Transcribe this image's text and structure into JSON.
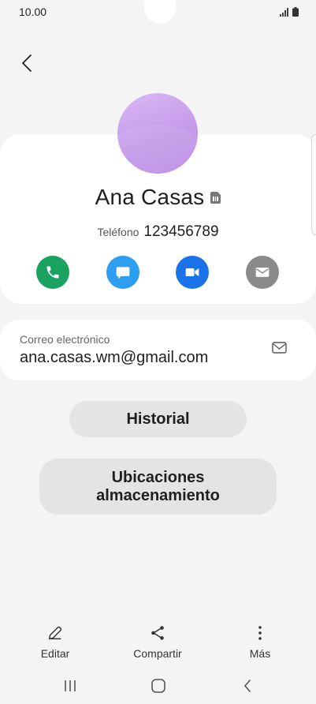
{
  "status_bar": {
    "time": "10.00"
  },
  "contact": {
    "name": "Ana Casas",
    "phone_label": "Teléfono",
    "phone_number": "123456789"
  },
  "actions": [
    {
      "name": "call",
      "icon": "phone-icon",
      "color": "#1aa260"
    },
    {
      "name": "message",
      "icon": "message-icon",
      "color": "#2e9ff0"
    },
    {
      "name": "video",
      "icon": "video-icon",
      "color": "#1a73e8"
    },
    {
      "name": "email",
      "icon": "mail-icon",
      "color": "#8a8a8a"
    }
  ],
  "email": {
    "label": "Correo electrónico",
    "value": "ana.casas.wm@gmail.com"
  },
  "buttons": {
    "history": "Historial",
    "storage_line1": "Ubicaciones",
    "storage_line2": "almacenamiento"
  },
  "bottom_bar": {
    "edit": "Editar",
    "share": "Compartir",
    "more": "Más"
  },
  "colors": {
    "background": "#f4f4f4",
    "card": "#ffffff",
    "pill": "#e4e4e4",
    "avatar": "#c59ae9"
  }
}
